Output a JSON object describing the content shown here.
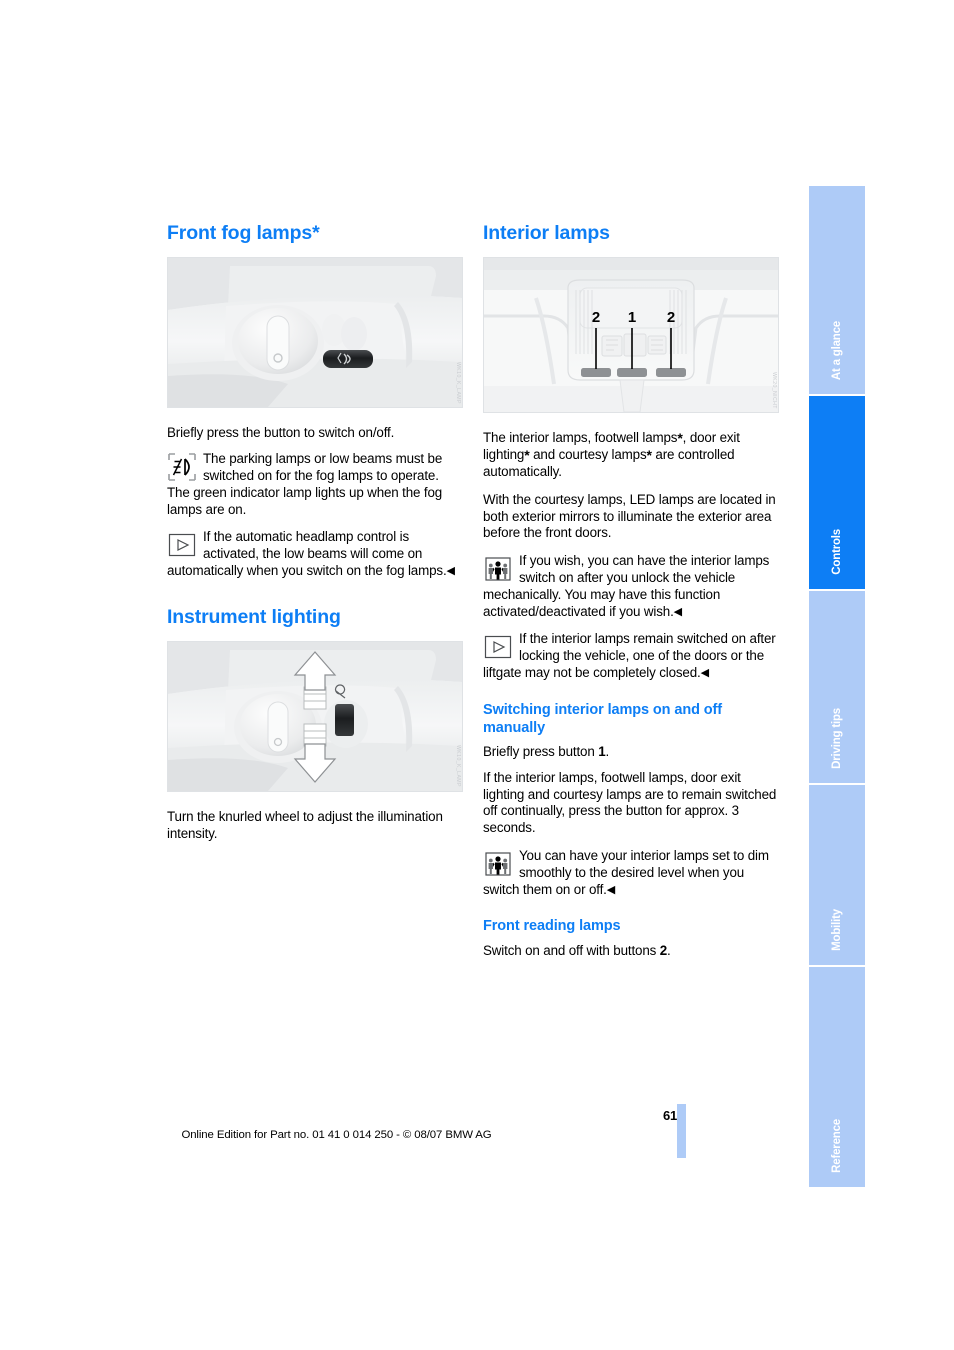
{
  "page": {
    "number": "61",
    "footer_line": "Online Edition for Part no. 01 41 0 014 250 - © 08/07 BMW AG",
    "accent_blue": "#0d7ef5",
    "tab_blue_inactive": "#aecbf7"
  },
  "sidebar": {
    "tabs": [
      {
        "label": "At a glance",
        "active": false
      },
      {
        "label": "Controls",
        "active": true
      },
      {
        "label": "Driving tips",
        "active": false
      },
      {
        "label": "Mobility",
        "active": false
      },
      {
        "label": "Reference",
        "active": false
      }
    ]
  },
  "left_column": {
    "heading_fog": "Front fog lamps*",
    "figure_fog": {
      "name": "fog-lamp-switch-photo",
      "watermark": "WK10_K_LAMP"
    },
    "fog_intro": "Briefly press the button to switch on/off.",
    "fog_note_1": {
      "icon": "fog-lamp-indicator-icon",
      "text": "The parking lamps or low beams must be switched on for the fog lamps to operate. The green indicator lamp lights up when the fog lamps are on."
    },
    "fog_note_2": {
      "icon": "triangle-tip-icon",
      "text": "If the automatic headlamp control is activated, the low beams will come on automatically when you switch on the fog lamps.",
      "endmark": "◀"
    },
    "heading_instrument": "Instrument lighting",
    "figure_instrument": {
      "name": "knurled-wheel-photo",
      "watermark": "WK10_K_LAMP"
    },
    "instrument_text": "Turn the knurled wheel to adjust the illumination intensity."
  },
  "right_column": {
    "heading_interior": "Interior lamps",
    "figure_interior": {
      "name": "overhead-console-photo",
      "watermark": "WK20_NICHT",
      "callouts": [
        "2",
        "1",
        "2"
      ]
    },
    "para_1_parts": {
      "a": "The interior lamps, footwell lamps",
      "star1": "*",
      "b": ", door exit lighting",
      "star2": "*",
      "c": " and courtesy lamps",
      "star3": "*",
      "d": " are controlled automatically."
    },
    "para_2": "With the courtesy lamps, LED lamps are located in both exterior mirrors to illuminate the exterior area before the front doors.",
    "note_1": {
      "icon": "service-people-icon",
      "text": "If you wish, you can have the interior lamps switch on after you unlock the vehicle mechanically. You may have this function activated/deactivated if you wish.",
      "endmark": "◀"
    },
    "note_2": {
      "icon": "triangle-tip-icon",
      "text": "If the interior lamps remain switched on after locking the vehicle, one of the doors or the liftgate may not be completely closed.",
      "endmark": "◀"
    },
    "heading_manual": "Switching interior lamps on and off manually",
    "manual_line_a": "Briefly press button ",
    "manual_line_a_bold": "1",
    "manual_line_a_end": ".",
    "manual_para": "If the interior lamps, footwell lamps, door exit lighting and courtesy lamps are to remain switched off continually, press the button for approx. 3 seconds.",
    "note_3": {
      "icon": "service-people-icon",
      "text": "You can have your interior lamps set to dim smoothly to the desired level when you switch them on or off.",
      "endmark": "◀"
    },
    "heading_reading": "Front reading lamps",
    "reading_line_a": "Switch on and off with buttons ",
    "reading_line_a_bold": "2",
    "reading_line_a_end": "."
  }
}
